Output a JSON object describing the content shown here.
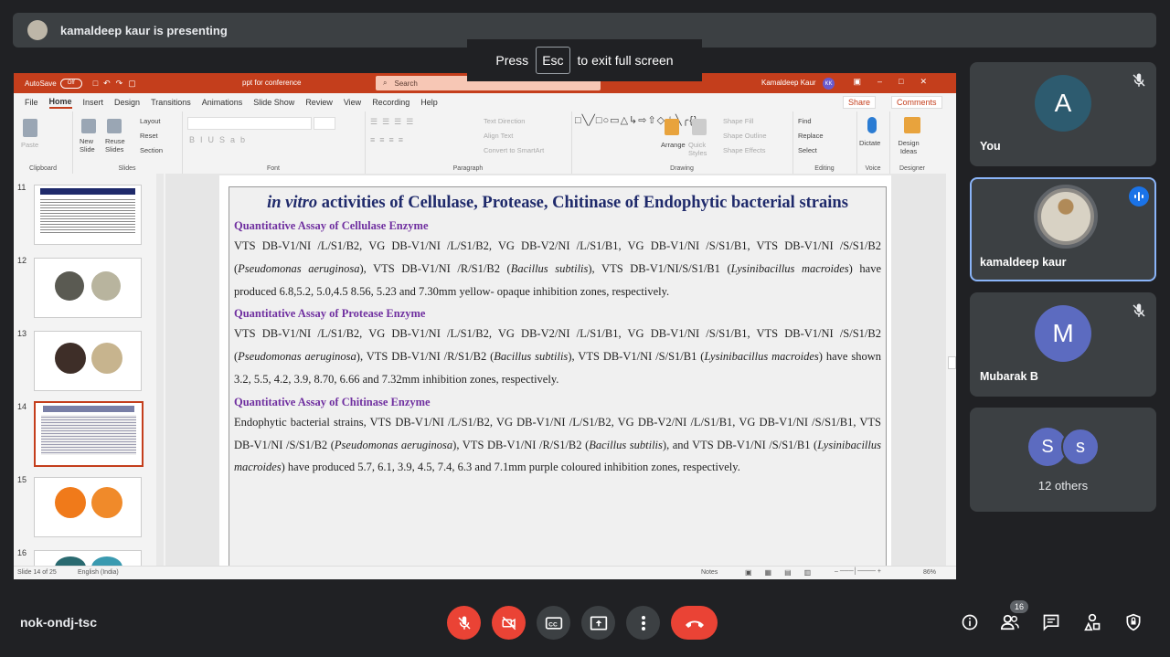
{
  "presenter": {
    "text": "kamaldeep kaur is presenting"
  },
  "esc_banner": {
    "press": "Press",
    "key": "Esc",
    "rest": "to exit full screen"
  },
  "ppt": {
    "autosave": "AutoSave",
    "toggle": "Off",
    "doc_title": "ppt for conference",
    "search": "Search",
    "user": "Kamaldeep Kaur",
    "user_initials": "KK",
    "menu": [
      "File",
      "Home",
      "Insert",
      "Design",
      "Transitions",
      "Animations",
      "Slide Show",
      "Review",
      "View",
      "Recording",
      "Help"
    ],
    "share": "Share",
    "comments": "Comments",
    "ribbon": {
      "clipboard": "Clipboard",
      "paste": "Paste",
      "slides": "Slides",
      "new_slide": "New Slide",
      "reuse_slides": "Reuse Slides",
      "layout": "Layout",
      "reset": "Reset",
      "section": "Section",
      "font": "Font",
      "paragraph": "Paragraph",
      "text_direction": "Text Direction",
      "align_text": "Align Text",
      "convert_smartart": "Convert to SmartArt",
      "drawing": "Drawing",
      "arrange": "Arrange",
      "quick_styles": "Quick Styles",
      "shape_fill": "Shape Fill",
      "shape_outline": "Shape Outline",
      "shape_effects": "Shape Effects",
      "editing": "Editing",
      "find": "Find",
      "replace": "Replace",
      "select": "Select",
      "voice": "Voice",
      "dictate": "Dictate",
      "designer": "Designer",
      "design_ideas": "Design Ideas"
    },
    "thumb_numbers": [
      "11",
      "12",
      "13",
      "14",
      "15",
      "16"
    ],
    "status": {
      "slide": "Slide 14 of 25",
      "lang": "English (India)",
      "notes": "Notes",
      "zoom": "86%"
    }
  },
  "slide": {
    "title_italic": "in vitro",
    "title_rest": " activities of Cellulase, Protease, Chitinase of Endophytic bacterial strains",
    "h1": "Quantitative Assay of Cellulase Enzyme",
    "p1a": "VTS DB-V1/NI /L/S1/B2, VG DB-V1/NI /L/S1/B2, VG DB-V2/NI /L/S1/B1, VG DB-V1/NI /S/S1/B1, VTS DB-V1/NI /S/S1/B2 (",
    "p1b": "Pseudomonas aeruginosa",
    "p1c": "), VTS DB-V1/NI /R/S1/B2 (",
    "p1d": "Bacillus subtilis",
    "p1e": "), VTS DB-V1/NI/S/S1/B1 (",
    "p1f": "Lysinibacillus macroides",
    "p1g": ") have produced 6.8,5.2, 5.0,4.5 8.56, 5.23 and 7.30mm yellow- opaque inhibition zones, respectively.",
    "h2": "Quantitative Assay of Protease Enzyme",
    "p2a": "VTS DB-V1/NI /L/S1/B2, VG DB-V1/NI /L/S1/B2, VG DB-V2/NI /L/S1/B1, VG DB-V1/NI /S/S1/B1, VTS DB-V1/NI /S/S1/B2 (",
    "p2b": "Pseudomonas aeruginosa",
    "p2c": "), VTS DB-V1/NI /R/S1/B2 (",
    "p2d": "Bacillus subtilis",
    "p2e": "), VTS DB-V1/NI /S/S1/B1 (",
    "p2f": "Lysinibacillus macroides",
    "p2g": ") have shown 3.2, 5.5, 4.2, 3.9, 8.70, 6.66 and 7.32mm inhibition zones, respectively.",
    "h3": "Quantitative Assay of Chitinase Enzyme",
    "p3a": "Endophytic bacterial strains, VTS DB-V1/NI /L/S1/B2, VG DB-V1/NI /L/S1/B2, VG DB-V2/NI /L/S1/B1, VG DB-V1/NI /S/S1/B1, VTS DB-V1/NI /S/S1/B2 (",
    "p3b": "Pseudomonas aeruginosa",
    "p3c": "), VTS DB-V1/NI /R/S1/B2 (",
    "p3d": "Bacillus subtilis",
    "p3e": "), and VTS DB-V1/NI /S/S1/B1 (",
    "p3f": "Lysinibacillus macroides",
    "p3g": ") have produced 5.7, 6.1, 3.9, 4.5, 7.4, 6.3 and 7.1mm purple coloured inhibition zones, respectively."
  },
  "participants": {
    "you": {
      "initial": "A",
      "name": "You",
      "color": "#2d5b6f"
    },
    "kamaldeep": {
      "name": "kamaldeep kaur"
    },
    "mubarak": {
      "initial": "M",
      "name": "Mubarak B",
      "color": "#5c6bc0"
    },
    "others": {
      "initials": [
        "S",
        "s"
      ],
      "label": "12 others",
      "color": "#5c6bc0"
    }
  },
  "bottom": {
    "meeting_code": "nok-ondj-tsc",
    "participants_count": "16",
    "colors": {
      "danger": "#ea4335",
      "neutral": "#3c4043"
    },
    "icons": [
      "mic-off-icon",
      "camera-off-icon",
      "captions-icon",
      "present-icon",
      "more-icon",
      "hang-up-icon",
      "info-icon",
      "people-icon",
      "chat-icon",
      "activities-icon",
      "host-controls-icon"
    ]
  }
}
